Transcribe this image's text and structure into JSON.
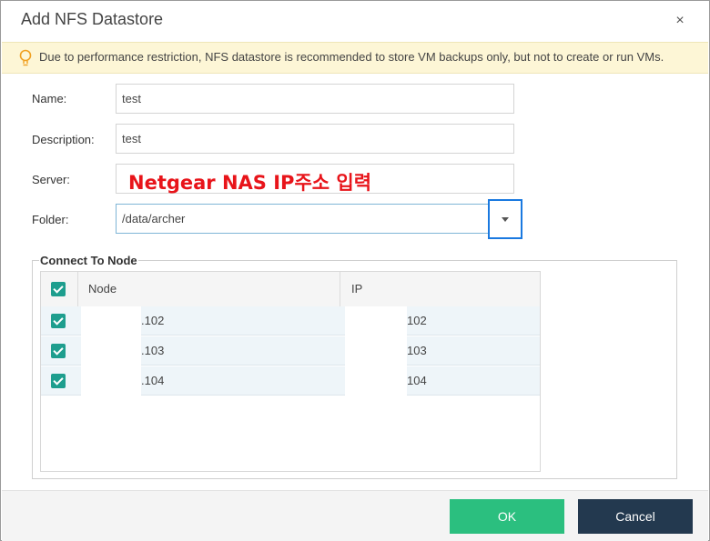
{
  "dialog": {
    "title": "Add NFS Datastore",
    "close_symbol": "×"
  },
  "notice": {
    "icon": "lightbulb-icon",
    "text": "Due to performance restriction, NFS datastore is recommended to store VM backups only, but not to create or run VMs."
  },
  "form": {
    "name_label": "Name:",
    "name_value": "test",
    "description_label": "Description:",
    "description_value": "test",
    "server_label": "Server:",
    "server_value": "",
    "server_annotation": "Netgear NAS IP주소 입력",
    "folder_label": "Folder:",
    "folder_value": "/data/archer"
  },
  "connect": {
    "legend": "Connect To Node",
    "columns": [
      "Node",
      "IP"
    ],
    "rows": [
      {
        "node": ".102",
        "ip": "102",
        "checked": true
      },
      {
        "node": ".103",
        "ip": "103",
        "checked": true
      },
      {
        "node": ".104",
        "ip": "104",
        "checked": true
      }
    ]
  },
  "buttons": {
    "ok": "OK",
    "cancel": "Cancel"
  },
  "colors": {
    "accent_green": "#2bbf7f",
    "dark_navy": "#23394f",
    "checkbox_teal": "#1e9e8e",
    "annotation_red": "#e8141a",
    "highlight_blue": "#1a79e0"
  }
}
